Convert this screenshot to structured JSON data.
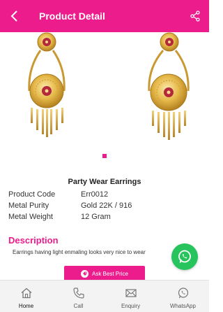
{
  "header": {
    "title": "Product Detail",
    "back_icon": "chevron-left-icon",
    "share_icon": "share-icon"
  },
  "gallery": {
    "image_subject": "gold earrings with red stones",
    "active_page": 1,
    "page_count": 1
  },
  "product": {
    "name": "Party Wear Earrings",
    "specs": [
      {
        "label": "Product Code",
        "value": "Err0012"
      },
      {
        "label": "Metal Purity",
        "value": "Gold 22K / 916"
      },
      {
        "label": "Metal Weight",
        "value": "12 Gram"
      }
    ],
    "description_heading": "Description",
    "description_text": "Earrings having light enmaling looks very nice to wear"
  },
  "actions": {
    "ask_price_label": "Ask Best Price"
  },
  "bottom_nav": {
    "items": [
      {
        "label": "Home",
        "icon": "home-icon"
      },
      {
        "label": "Call",
        "icon": "phone-icon"
      },
      {
        "label": "Enquiry",
        "icon": "mail-icon"
      },
      {
        "label": "WhatsApp",
        "icon": "whatsapp-icon"
      }
    ],
    "active_index": 0
  },
  "colors": {
    "accent": "#ec1c8c",
    "whatsapp": "#27c45e",
    "nav_background": "#f3f3f3"
  }
}
